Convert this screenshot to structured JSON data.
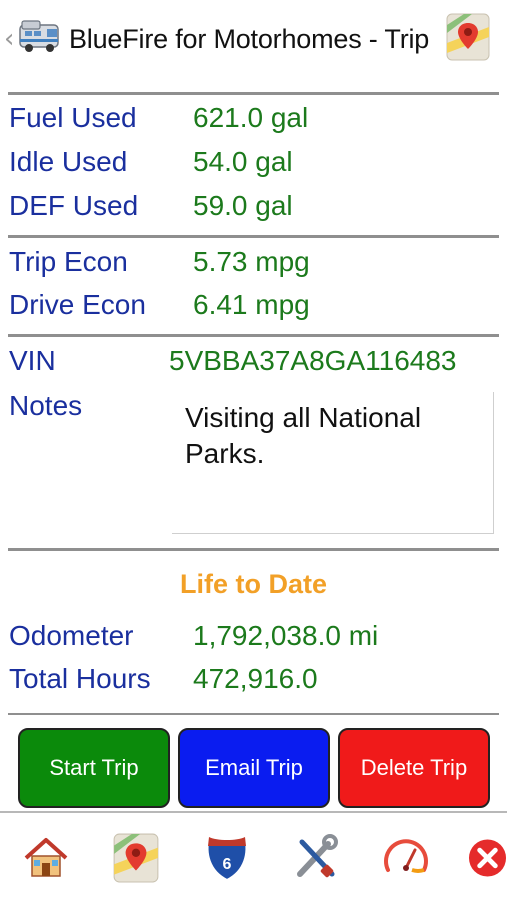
{
  "header": {
    "back_glyph": "‹",
    "app_icon": "motorhome-icon",
    "title": "BlueFire for Motorhomes - Trip",
    "map_icon": "map-pin-icon"
  },
  "fuel": {
    "fuel_used_label": "Fuel Used",
    "fuel_used_value": "621.0 gal",
    "idle_used_label": "Idle Used",
    "idle_used_value": "54.0 gal",
    "def_used_label": "DEF Used",
    "def_used_value": "59.0 gal"
  },
  "econ": {
    "trip_econ_label": "Trip Econ",
    "trip_econ_value": "5.73 mpg",
    "drive_econ_label": "Drive Econ",
    "drive_econ_value": "6.41 mpg"
  },
  "vehicle": {
    "vin_label": "VIN",
    "vin_value": "5VBBA37A8GA116483",
    "notes_label": "Notes",
    "notes_value": "Visiting all National Parks."
  },
  "life_to_date": {
    "title": "Life to Date",
    "odometer_label": "Odometer",
    "odometer_value": "1,792,038.0 mi",
    "total_hours_label": "Total Hours",
    "total_hours_value": "472,916.0"
  },
  "buttons": {
    "start_trip": "Start Trip",
    "email_trip": "Email Trip",
    "delete_trip": "Delete Trip"
  },
  "nav": {
    "items": [
      "home-icon",
      "map-pin-icon",
      "interstate-shield-icon",
      "tools-icon",
      "gauge-icon",
      "close-icon"
    ],
    "shield_number": "6"
  },
  "colors": {
    "label_blue": "#1a2f9e",
    "value_green": "#1c7a1c",
    "accent_orange": "#f2a027",
    "start_green": "#0b8a0b",
    "email_blue": "#0a1cf0",
    "delete_red": "#f01a1a"
  }
}
